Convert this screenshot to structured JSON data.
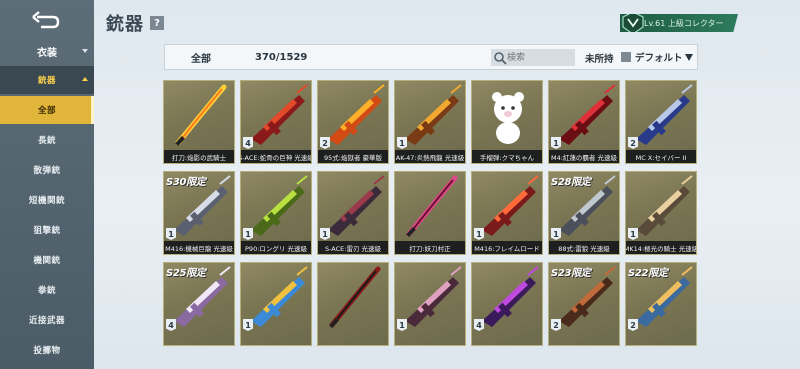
{
  "header": {
    "title": "銃器",
    "help": "?",
    "collector_badge": "Lv.61 上級コレクター"
  },
  "sidebar": {
    "back_icon": "back-arrow-icon",
    "category": "衣装",
    "items": [
      {
        "label": "銃器",
        "state": "active-parent"
      },
      {
        "label": "全部",
        "state": "selected"
      },
      {
        "label": "長銃",
        "state": ""
      },
      {
        "label": "散弾銃",
        "state": ""
      },
      {
        "label": "短機関銃",
        "state": ""
      },
      {
        "label": "狙撃銃",
        "state": ""
      },
      {
        "label": "機関銃",
        "state": ""
      },
      {
        "label": "拳銃",
        "state": ""
      },
      {
        "label": "近接武器",
        "state": ""
      },
      {
        "label": "投擲物",
        "state": ""
      }
    ]
  },
  "filter": {
    "all": "全部",
    "count": "370/1529",
    "search_placeholder": "検索",
    "unowned": "未所持",
    "sort": "デフォルト"
  },
  "cards": [
    {
      "label": "打刀:焔影の武騎士",
      "stars": "",
      "season": "",
      "art": "blade-fire"
    },
    {
      "label": "S-ACE:蛇骨の巨神 光速級",
      "stars": "4",
      "season": "",
      "art": "rifle-red"
    },
    {
      "label": "95式:焔獄者 豪華版",
      "stars": "2",
      "season": "",
      "art": "rifle-orange"
    },
    {
      "label": "AK-47:炎熱飛龍 光速級",
      "stars": "1",
      "season": "",
      "art": "rifle-gold"
    },
    {
      "label": "手榴弾:クマちゃん",
      "stars": "",
      "season": "",
      "art": "bear"
    },
    {
      "label": "M4:紅蓮の覇者 光速級",
      "stars": "1",
      "season": "",
      "art": "rifle-crimson"
    },
    {
      "label": "MC X:セイバー II",
      "stars": "2",
      "season": "",
      "art": "rifle-blue"
    },
    {
      "label": "M416:機械巨龍 光速級",
      "stars": "1",
      "season": "S30限定",
      "art": "rifle-silver"
    },
    {
      "label": "P90:ロングリ 光速級",
      "stars": "1",
      "season": "",
      "art": "smg-green"
    },
    {
      "label": "S-ACE:雷刃 光速級",
      "stars": "1",
      "season": "",
      "art": "rifle-dark"
    },
    {
      "label": "打刀:妖刀村正",
      "stars": "",
      "season": "",
      "art": "katana-pink"
    },
    {
      "label": "M416:フレイムロード",
      "stars": "1",
      "season": "",
      "art": "rifle-fire2"
    },
    {
      "label": "88式:雷狼 光速級",
      "stars": "1",
      "season": "S28限定",
      "art": "rifle-grey"
    },
    {
      "label": "MK14:極光の騎士 光速級",
      "stars": "1",
      "season": "",
      "art": "rifle-ornate"
    },
    {
      "label": "",
      "stars": "4",
      "season": "S25限定",
      "art": "rifle-white"
    },
    {
      "label": "",
      "stars": "1",
      "season": "",
      "art": "rifle-rainbow"
    },
    {
      "label": "",
      "stars": "",
      "season": "",
      "art": "katana-black"
    },
    {
      "label": "",
      "stars": "1",
      "season": "",
      "art": "rifle-purple"
    },
    {
      "label": "",
      "stars": "4",
      "season": "",
      "art": "rifle-violet"
    },
    {
      "label": "",
      "stars": "2",
      "season": "S23限定",
      "art": "rifle-brown"
    },
    {
      "label": "",
      "stars": "2",
      "season": "S22限定",
      "art": "rifle-cyan"
    }
  ],
  "colors": {
    "sidebar": "#4f5f6a",
    "selected": "#e0b53a",
    "card_bg": "#7a7552",
    "badge": "#2d7b5e"
  }
}
